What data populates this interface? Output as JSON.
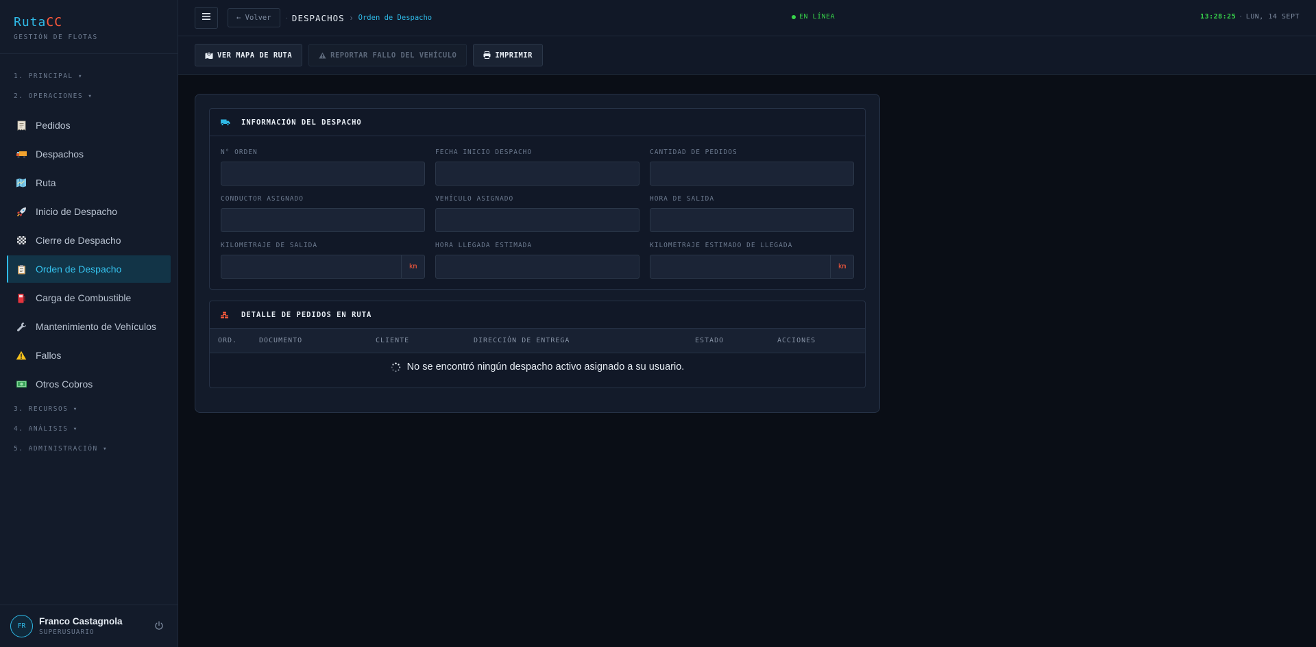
{
  "brand": {
    "name_a": "Ruta",
    "name_b": "CC",
    "subtitle": "GESTIÓN DE FLOTAS",
    "accent": "#2fb9e6",
    "accent_alt": "#ff5a3c"
  },
  "sidebar": {
    "sections": [
      {
        "title": "1. PRINCIPAL ▾"
      },
      {
        "title": "2. OPERACIONES ▾"
      },
      {
        "title": "3. RECURSOS ▾"
      },
      {
        "title": "4. ANÁLISIS ▾"
      },
      {
        "title": "5. ADMINISTRACIÓN ▾"
      }
    ],
    "items": [
      {
        "label": "Pedidos",
        "icon": "receipt-icon"
      },
      {
        "label": "Despachos",
        "icon": "truck-icon"
      },
      {
        "label": "Ruta",
        "icon": "map-icon"
      },
      {
        "label": "Inicio de Despacho",
        "icon": "rocket-icon"
      },
      {
        "label": "Cierre de Despacho",
        "icon": "checkered-flag-icon"
      },
      {
        "label": "Orden de Despacho",
        "icon": "clipboard-icon",
        "active": true
      },
      {
        "label": "Carga de Combustible",
        "icon": "fuel-icon"
      },
      {
        "label": "Mantenimiento de Vehículos",
        "icon": "wrench-icon"
      },
      {
        "label": "Fallos",
        "icon": "warning-icon"
      },
      {
        "label": "Otros Cobros",
        "icon": "money-icon"
      }
    ]
  },
  "user": {
    "initials": "FR",
    "name": "Franco Castagnola",
    "role": "SUPERUSUARIO"
  },
  "topbar": {
    "back_label": "← Volver",
    "crumb_dot": "·",
    "crumb_main": "DESPACHOS",
    "crumb_sep": "›",
    "crumb_current": "Orden de Despacho",
    "status": "EN LÍNEA",
    "status_color": "#37d44a",
    "time": "13:28:25",
    "clock_sep": "·",
    "date": "LUN, 14 SEPT"
  },
  "toolbar": {
    "map_label": "VER MAPA DE RUTA",
    "report_label": "REPORTAR FALLO DEL VEHÍCULO",
    "print_label": "IMPRIMIR"
  },
  "dispatch_info": {
    "title": "INFORMACIÓN DEL DESPACHO",
    "fields": [
      {
        "label": "N° ORDEN",
        "value": ""
      },
      {
        "label": "FECHA INICIO DESPACHO",
        "value": ""
      },
      {
        "label": "CANTIDAD DE PEDIDOS",
        "value": ""
      },
      {
        "label": "CONDUCTOR ASIGNADO",
        "value": ""
      },
      {
        "label": "VEHÍCULO ASIGNADO",
        "value": ""
      },
      {
        "label": "HORA DE SALIDA",
        "value": ""
      },
      {
        "label": "KILOMETRAJE DE SALIDA",
        "value": "",
        "unit": "km"
      },
      {
        "label": "HORA LLEGADA ESTIMADA",
        "value": ""
      },
      {
        "label": "KILOMETRAJE ESTIMADO DE LLEGADA",
        "value": "",
        "unit": "km"
      }
    ]
  },
  "orders": {
    "title": "DETALLE DE PEDIDOS EN RUTA",
    "columns": [
      "ORD.",
      "DOCUMENTO",
      "CLIENTE",
      "DIRECCIÓN DE ENTREGA",
      "ESTADO",
      "ACCIONES"
    ],
    "empty_message": "No se encontró ningún despacho activo asignado a su usuario."
  }
}
